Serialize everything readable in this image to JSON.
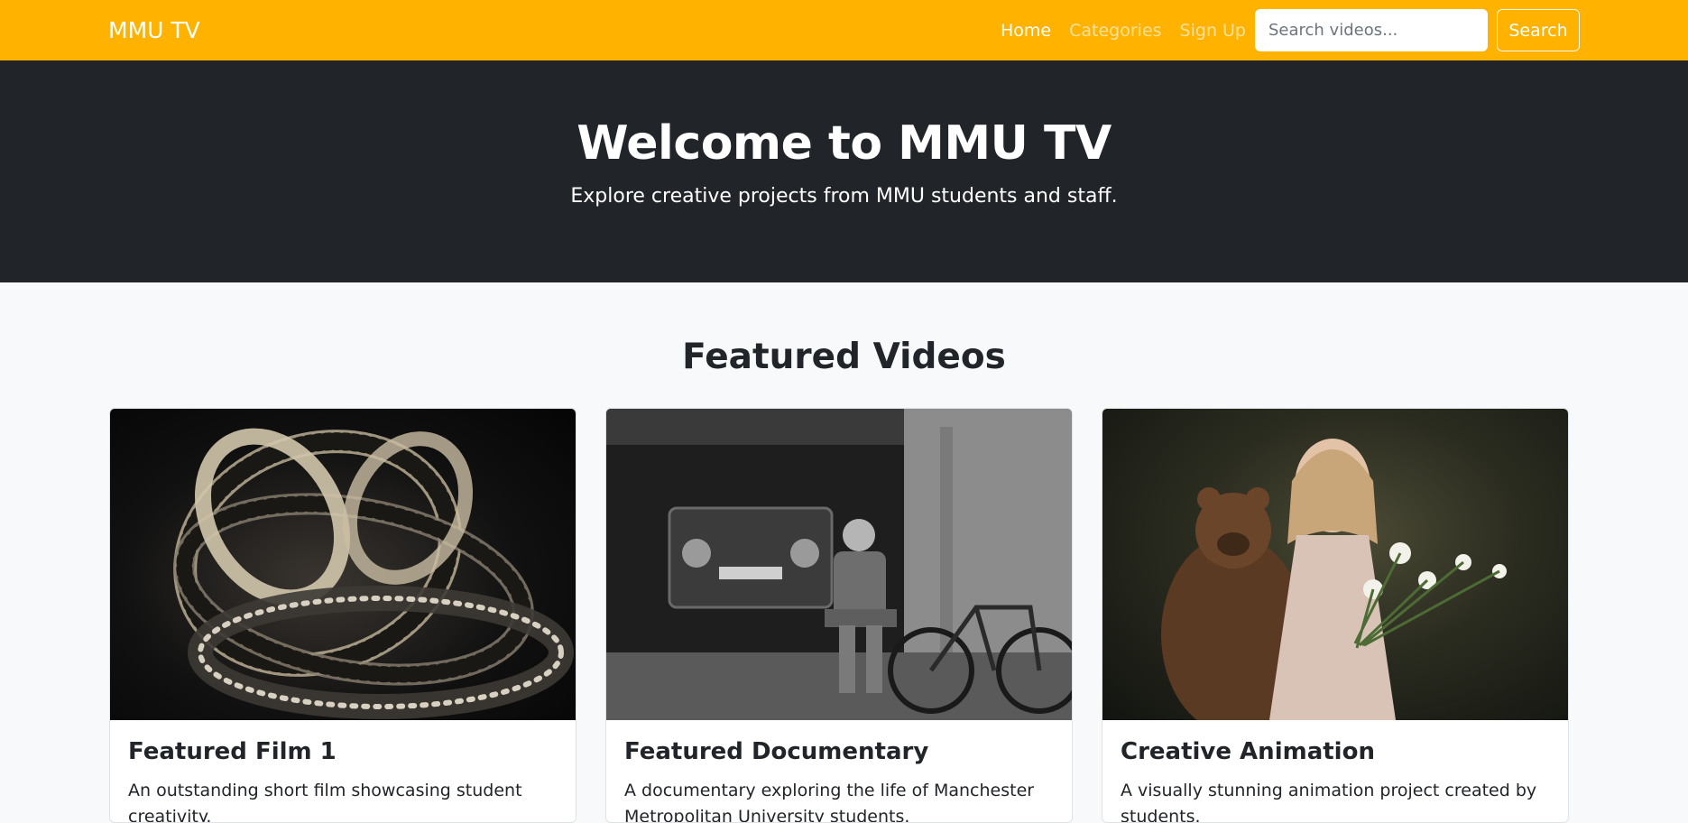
{
  "navbar": {
    "brand": "MMU TV",
    "links": [
      {
        "label": "Home",
        "active": true
      },
      {
        "label": "Categories",
        "active": false
      },
      {
        "label": "Sign Up",
        "active": false
      }
    ],
    "search_placeholder": "Search videos...",
    "search_button": "Search"
  },
  "hero": {
    "title": "Welcome to MMU TV",
    "subtitle": "Explore creative projects from MMU students and staff."
  },
  "featured": {
    "title": "Featured Videos",
    "cards": [
      {
        "title": "Featured Film 1",
        "text": "An outstanding short film showcasing student creativity."
      },
      {
        "title": "Featured Documentary",
        "text": "A documentary exploring the life of Manchester Metropolitan University students."
      },
      {
        "title": "Creative Animation",
        "text": "A visually stunning animation project created by students."
      }
    ]
  },
  "colors": {
    "navbar": "#ffb300",
    "hero": "#212529",
    "page_bg": "#f8f9fa"
  }
}
